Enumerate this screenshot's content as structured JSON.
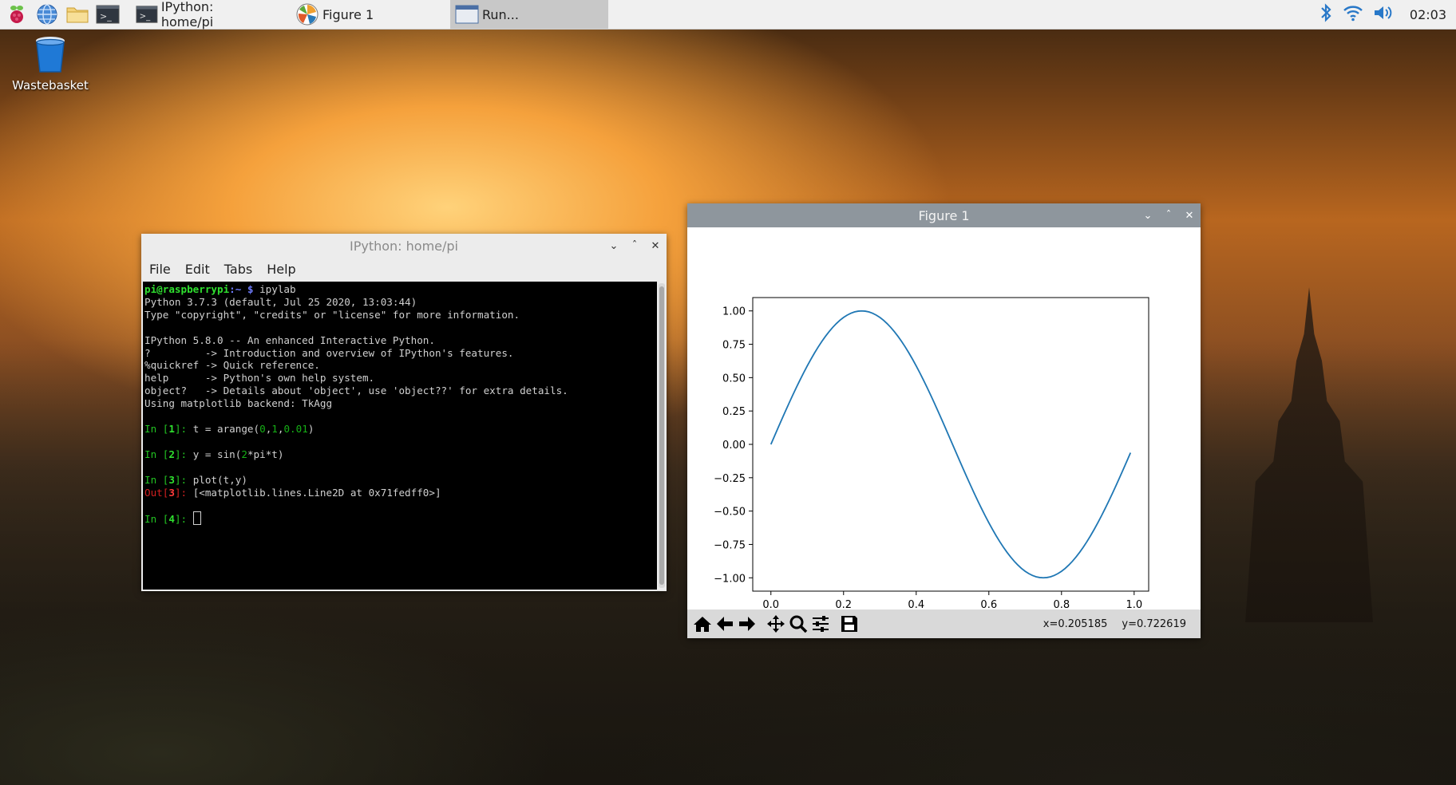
{
  "taskbar": {
    "launchers": [
      "raspberry-menu-icon",
      "web-browser-icon",
      "file-manager-icon",
      "terminal-icon"
    ],
    "tasks": [
      {
        "label": "IPython: home/pi",
        "icon": "terminal-icon"
      },
      {
        "label": "Figure 1",
        "icon": "matplotlib-icon"
      },
      {
        "label": "Run...",
        "icon": "window-icon"
      }
    ],
    "clock": "02:03"
  },
  "desktop": {
    "icons": [
      {
        "label": "Wastebasket",
        "icon": "trash-icon"
      }
    ]
  },
  "terminal_window": {
    "title": "IPython: home/pi",
    "menu": [
      "File",
      "Edit",
      "Tabs",
      "Help"
    ],
    "prompt_user": "pi@raspberrypi",
    "prompt_dir": ":~ ",
    "prompt_sign": "$",
    "command": " ipylab",
    "banner": [
      "Python 3.7.3 (default, Jul 25 2020, 13:03:44)",
      "Type \"copyright\", \"credits\" or \"license\" for more information.",
      "",
      "IPython 5.8.0 -- An enhanced Interactive Python.",
      "?         -> Introduction and overview of IPython's features.",
      "%quickref -> Quick reference.",
      "help      -> Python's own help system.",
      "object?   -> Details about 'object', use 'object??' for extra details.",
      "Using matplotlib backend: TkAgg"
    ],
    "cells": [
      {
        "n": "1",
        "code_pre": "t = arange(",
        "nums": [
          "0",
          "1",
          "0.01"
        ],
        "code_post": ")"
      },
      {
        "n": "2",
        "code": "y = sin(",
        "num": "2",
        "code_end": "*pi*t)"
      },
      {
        "n": "3",
        "code": "plot(t,y)",
        "out": "[<matplotlib.lines.Line2D at 0x71fedff0>]"
      },
      {
        "n": "4"
      }
    ],
    "in_label": "In [",
    "out_label": "Out["
  },
  "figure_window": {
    "title": "Figure 1",
    "toolbar": [
      "home-icon",
      "back-icon",
      "forward-icon",
      "pan-icon",
      "zoom-icon",
      "configure-subplots-icon",
      "save-icon"
    ],
    "coord_x": "x=0.205185",
    "coord_y": "y=0.722619"
  },
  "chart_data": {
    "type": "line",
    "title": "",
    "xlabel": "",
    "ylabel": "",
    "function": "y = sin(2*pi*t)",
    "x_start": 0.0,
    "x_stop": 1.0,
    "x_step": 0.01,
    "xlim": [
      -0.05,
      1.04
    ],
    "ylim": [
      -1.1,
      1.1
    ],
    "x_ticks": [
      "0.0",
      "0.2",
      "0.4",
      "0.6",
      "0.8",
      "1.0"
    ],
    "y_ticks": [
      "1.00",
      "0.75",
      "0.50",
      "0.25",
      "0.00",
      "−0.25",
      "−0.50",
      "−0.75",
      "−1.00"
    ],
    "line_color": "#1f77b4",
    "grid": false
  }
}
